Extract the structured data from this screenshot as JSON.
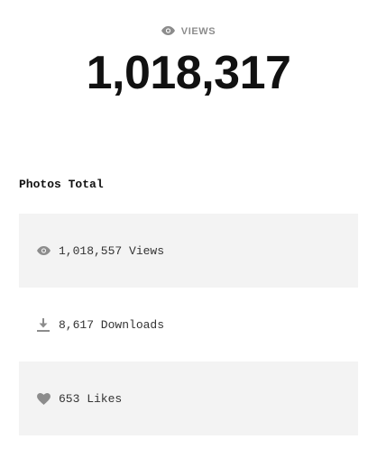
{
  "header": {
    "icon": "eye-icon",
    "label": "VIEWS",
    "total": "1,018,317"
  },
  "photos": {
    "title": "Photos Total",
    "stats": [
      {
        "icon": "eye-icon",
        "value": "1,018,557",
        "label": "Views",
        "text": "1,018,557 Views"
      },
      {
        "icon": "download-icon",
        "value": "8,617",
        "label": "Downloads",
        "text": "8,617 Downloads"
      },
      {
        "icon": "heart-icon",
        "value": "653",
        "label": "Likes",
        "text": "653 Likes"
      }
    ]
  },
  "colors": {
    "icon": "#8c8c8c",
    "row_background": "#f3f3f3",
    "big_number": "#111111"
  }
}
